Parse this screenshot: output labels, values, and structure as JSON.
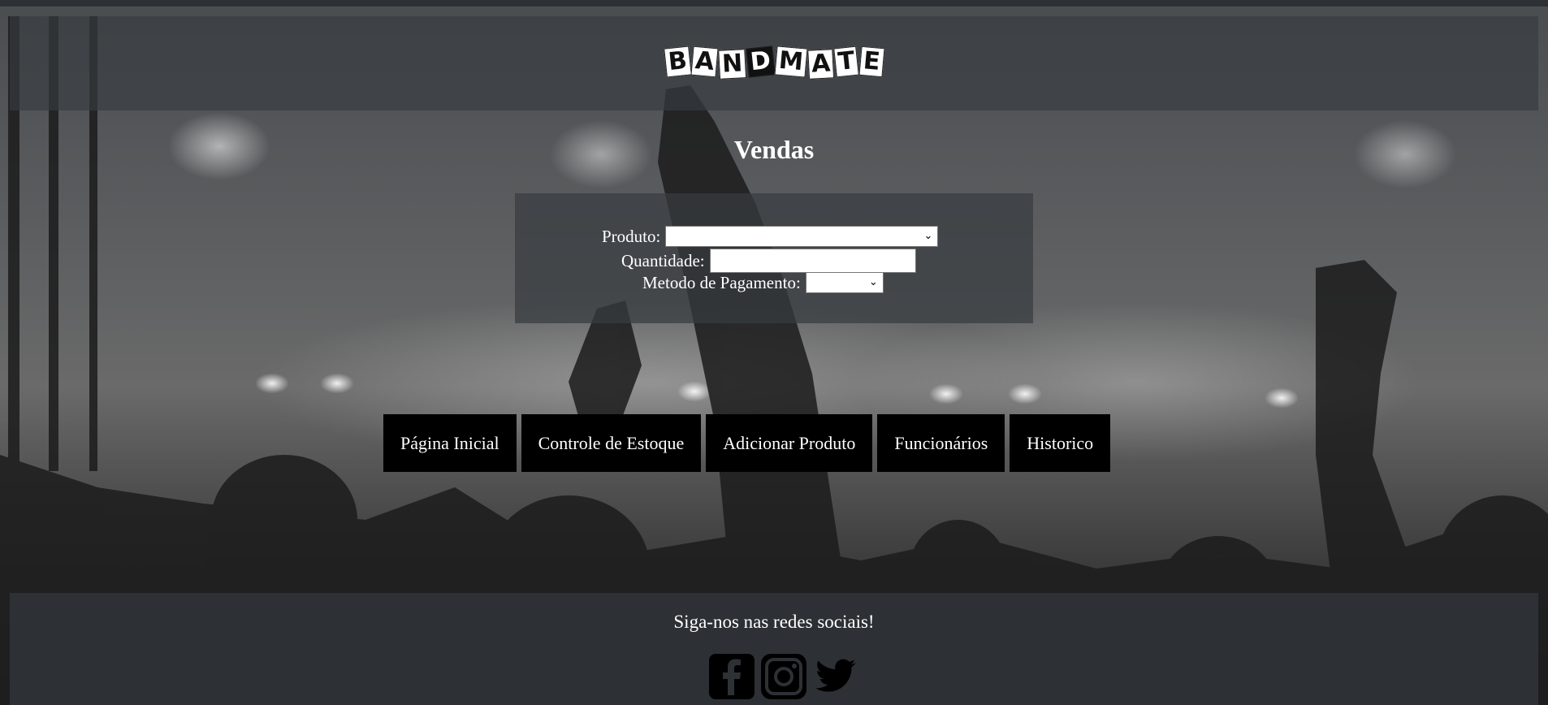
{
  "header": {
    "logo_letters": [
      "B",
      "A",
      "N",
      "D",
      "M",
      "A",
      "T",
      "E"
    ],
    "logo_text": "BANDMATE"
  },
  "page": {
    "title": "Vendas"
  },
  "form": {
    "product_label": "Produto:",
    "product_value": "",
    "quantity_label": "Quantidade:",
    "quantity_value": "",
    "payment_label": "Metodo de Pagamento:",
    "payment_value": ""
  },
  "nav": {
    "items": [
      {
        "label": "Página Inicial"
      },
      {
        "label": "Controle de Estoque"
      },
      {
        "label": "Adicionar Produto"
      },
      {
        "label": "Funcionários"
      },
      {
        "label": "Historico"
      }
    ]
  },
  "footer": {
    "text": "Siga-nos nas redes sociais!",
    "icons": [
      "facebook-icon",
      "instagram-icon",
      "twitter-icon"
    ]
  },
  "colors": {
    "header_bg": "#373c40",
    "footer_bg": "#2d3135",
    "nav_button_bg": "#000000",
    "text": "#ffffff"
  }
}
